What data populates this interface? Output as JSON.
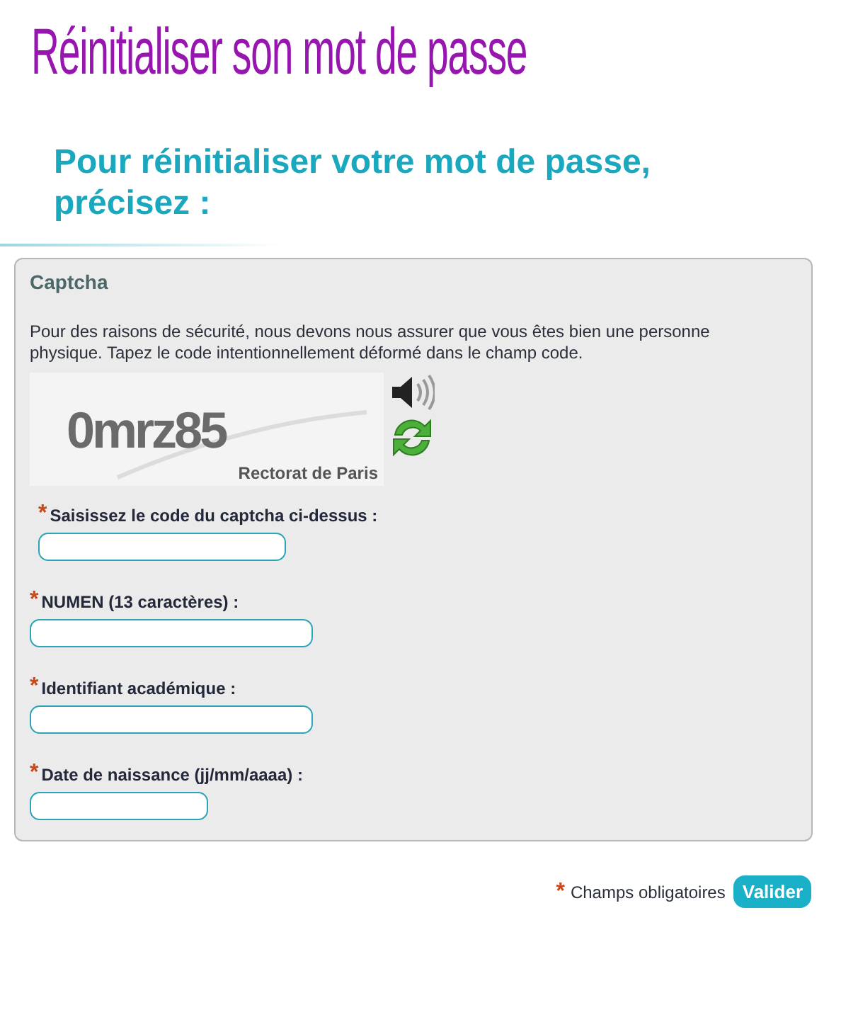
{
  "page_title": "Réinitialiser son mot de passe",
  "heading": "Pour réinitialiser votre mot de passe, précisez :",
  "captcha": {
    "legend": "Captcha",
    "description": "Pour des raisons de sécurité, nous devons nous assurer que vous êtes bien une personne physique. Tapez le code intentionnellement déformé dans le champ code.",
    "code": "0mrz85",
    "caption": "Rectorat de Paris"
  },
  "fields": [
    {
      "label": "Saisissez le code du captcha ci-dessus :",
      "marker": "*"
    },
    {
      "label": "NUMEN (13 caractères) :",
      "marker": "*"
    },
    {
      "label": "Identifiant académique :",
      "marker": "*"
    },
    {
      "label": "Date de naissance (jj/mm/aaaa) :",
      "marker": "*"
    }
  ],
  "footer": {
    "marker": "*",
    "note": "Champs obligatoires",
    "submit": "Valider"
  }
}
